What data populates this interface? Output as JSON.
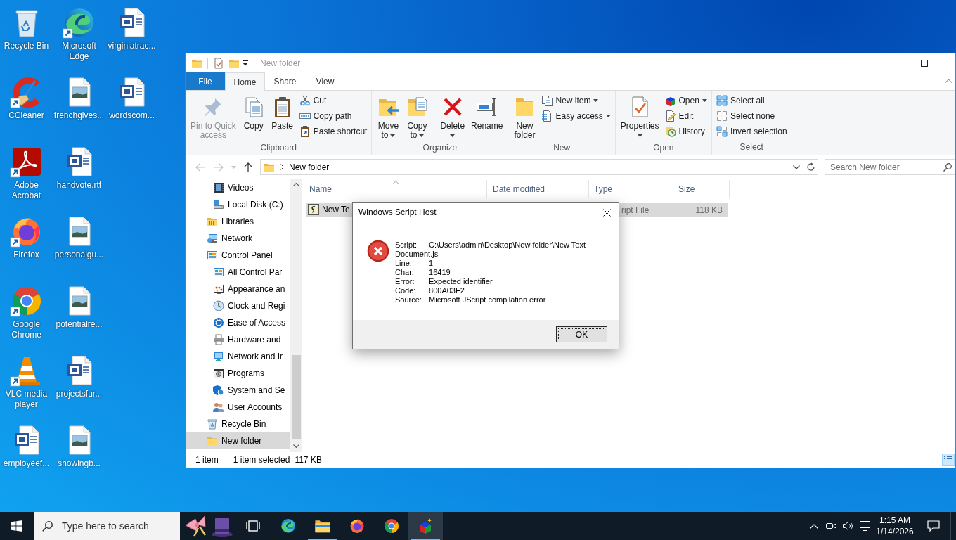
{
  "desktop_icons": [
    {
      "label": "Recycle Bin",
      "kind": "recyclebin",
      "shortcut": false
    },
    {
      "label": "CCleaner",
      "kind": "ccleaner",
      "shortcut": true
    },
    {
      "label": "Adobe Acrobat",
      "kind": "acrobat",
      "shortcut": true
    },
    {
      "label": "Firefox",
      "kind": "firefox",
      "shortcut": true
    },
    {
      "label": "Google Chrome",
      "kind": "chrome",
      "shortcut": true
    },
    {
      "label": "VLC media player",
      "kind": "vlc",
      "shortcut": true
    },
    {
      "label": "employeef...",
      "kind": "word",
      "shortcut": false
    },
    {
      "label": "Microsoft Edge",
      "kind": "edge",
      "shortcut": true
    },
    {
      "label": "frenchgives...",
      "kind": "image",
      "shortcut": false
    },
    {
      "label": "handvote.rtf",
      "kind": "word",
      "shortcut": false
    },
    {
      "label": "personalgu...",
      "kind": "image",
      "shortcut": false
    },
    {
      "label": "potentialre...",
      "kind": "image",
      "shortcut": false
    },
    {
      "label": "projectsfur...",
      "kind": "word",
      "shortcut": false
    },
    {
      "label": "showingb...",
      "kind": "image",
      "shortcut": false
    },
    {
      "label": "virginiatrac...",
      "kind": "word",
      "shortcut": false
    },
    {
      "label": "wordscom...",
      "kind": "word",
      "shortcut": false
    }
  ],
  "explorer": {
    "title": "New folder",
    "tabs": [
      {
        "label": "File",
        "kind": "file",
        "selected": false
      },
      {
        "label": "Home",
        "kind": "tab",
        "selected": true
      },
      {
        "label": "Share",
        "kind": "tab",
        "selected": false
      },
      {
        "label": "View",
        "kind": "tab",
        "selected": false
      }
    ],
    "ribbon_groups": [
      {
        "label": "Clipboard",
        "items": [
          {
            "kind": "large",
            "label": "Pin to Quick access",
            "disabled": true,
            "dropdown": false
          },
          {
            "kind": "large",
            "label": "Copy",
            "disabled": false,
            "dropdown": false
          },
          {
            "kind": "large",
            "label": "Paste",
            "disabled": false,
            "dropdown": false
          },
          {
            "kind": "small",
            "label": "Cut",
            "disabled": false,
            "dropdown": false
          },
          {
            "kind": "small",
            "label": "Copy path",
            "disabled": false,
            "dropdown": false
          },
          {
            "kind": "small",
            "label": "Paste shortcut",
            "disabled": false,
            "dropdown": false
          }
        ]
      },
      {
        "label": "Organize",
        "items": [
          {
            "kind": "large",
            "label": "Move to",
            "disabled": false,
            "dropdown": true
          },
          {
            "kind": "large",
            "label": "Copy to",
            "disabled": false,
            "dropdown": true
          },
          {
            "kind": "separator"
          },
          {
            "kind": "large",
            "label": "Delete",
            "disabled": false,
            "dropdown": true
          },
          {
            "kind": "large",
            "label": "Rename",
            "disabled": false,
            "dropdown": false
          }
        ]
      },
      {
        "label": "New",
        "items": [
          {
            "kind": "large",
            "label": "New folder",
            "disabled": false,
            "dropdown": false
          },
          {
            "kind": "small",
            "label": "New item",
            "disabled": false,
            "dropdown": true
          },
          {
            "kind": "small",
            "label": "Easy access",
            "disabled": false,
            "dropdown": true
          }
        ]
      },
      {
        "label": "Open",
        "items": [
          {
            "kind": "large",
            "label": "Properties",
            "disabled": false,
            "dropdown": true
          },
          {
            "kind": "small",
            "label": "Open",
            "disabled": false,
            "dropdown": true
          },
          {
            "kind": "small",
            "label": "Edit",
            "disabled": false,
            "dropdown": false
          },
          {
            "kind": "small",
            "label": "History",
            "disabled": false,
            "dropdown": false
          }
        ]
      },
      {
        "label": "Select",
        "items": [
          {
            "kind": "small",
            "label": "Select all",
            "disabled": false,
            "dropdown": false
          },
          {
            "kind": "small",
            "label": "Select none",
            "disabled": false,
            "dropdown": false
          },
          {
            "kind": "small",
            "label": "Invert selection",
            "disabled": false,
            "dropdown": false
          }
        ]
      }
    ],
    "nav_buttons": [
      {
        "kind": "back",
        "disabled": true
      },
      {
        "kind": "forward",
        "disabled": true
      },
      {
        "kind": "recent",
        "disabled": true
      },
      {
        "kind": "up",
        "disabled": false
      }
    ],
    "address": {
      "crumbs": [
        "New folder"
      ]
    },
    "search": {
      "placeholder": "Search New folder"
    },
    "navigation": [
      {
        "children": [
          {
            "label": "Videos",
            "selected": false
          },
          {
            "label": "Local Disk (C:)",
            "selected": false
          }
        ]
      },
      {
        "label": "Libraries",
        "selected": false
      },
      {
        "label": "Network",
        "selected": false
      },
      {
        "label": "Control Panel",
        "selected": false,
        "children": [
          {
            "label": "All Control Par",
            "selected": false
          },
          {
            "label": "Appearance an",
            "selected": false
          },
          {
            "label": "Clock and Regi",
            "selected": false
          },
          {
            "label": "Ease of Access",
            "selected": false
          },
          {
            "label": "Hardware and",
            "selected": false
          },
          {
            "label": "Network and Ir",
            "selected": false
          },
          {
            "label": "Programs",
            "selected": false
          },
          {
            "label": "System and Se",
            "selected": false
          },
          {
            "label": "User Accounts",
            "selected": false
          }
        ]
      },
      {
        "label": "Recycle Bin",
        "selected": false
      },
      {
        "label": "New folder",
        "selected": true
      }
    ],
    "columns": [
      {
        "label": "Name",
        "sorted": true
      },
      {
        "label": "Date modified",
        "sorted": false
      },
      {
        "label": "Type",
        "sorted": false
      },
      {
        "label": "Size",
        "sorted": false
      }
    ],
    "files": [
      {
        "name": "New Te",
        "type": "ript File",
        "size": "118 KB",
        "selected": true
      }
    ],
    "status_bar": {
      "item_count": "1 item",
      "selection": "1 item selected",
      "selection_size": "117 KB",
      "view_buttons": [
        {
          "kind": "details",
          "selected": true
        }
      ]
    }
  },
  "dialog": {
    "title": "Windows Script Host",
    "fields": [
      {
        "label": "Script:",
        "value": "C:\\Users\\admin\\Desktop\\New folder\\New Text Document.js"
      },
      {
        "label": "Line:",
        "value": "1"
      },
      {
        "label": "Char:",
        "value": "16419"
      },
      {
        "label": "Error:",
        "value": "Expected identifier"
      },
      {
        "label": "Code:",
        "value": "800A03F2"
      },
      {
        "label": "Source:",
        "value": "Microsoft JScript compilation error"
      }
    ],
    "buttons": [
      {
        "label": "OK",
        "focused": true
      }
    ]
  },
  "taskbar": {
    "search": {
      "placeholder": "Type here to search"
    },
    "apps": [
      {
        "kind": "taskview",
        "running": false,
        "active": false
      },
      {
        "kind": "edge",
        "running": false,
        "active": false
      },
      {
        "kind": "explorer",
        "running": true,
        "active": false
      },
      {
        "kind": "firefox",
        "running": false,
        "active": false
      },
      {
        "kind": "chrome",
        "running": false,
        "active": false
      },
      {
        "kind": "script",
        "running": true,
        "active": true
      }
    ],
    "clock": {
      "time": "1:15 AM",
      "date": "1/14/2026"
    }
  }
}
